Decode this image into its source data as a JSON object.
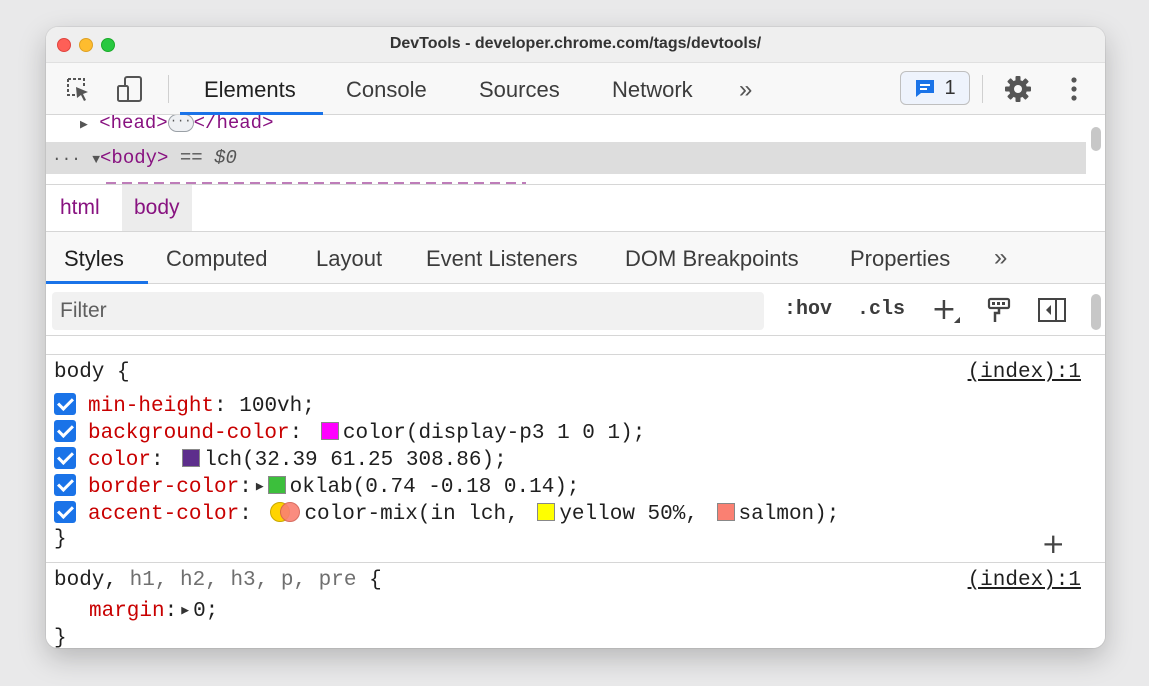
{
  "window": {
    "title": "DevTools - developer.chrome.com/tags/devtools/"
  },
  "toolbar": {
    "inspect_icon": "inspect-element-icon",
    "device_icon": "device-toolbar-icon",
    "tabs": [
      "Elements",
      "Console",
      "Sources",
      "Network"
    ],
    "active_tab": "Elements",
    "more": "»",
    "issues_count": "1",
    "settings_icon": "gear-icon",
    "menu_icon": "kebab-menu-icon"
  },
  "dom": {
    "head_open": "<head>",
    "head_ellipsis": "···",
    "head_close": "</head>",
    "body_dots": "···",
    "body_tag": "<body>",
    "body_eq": "==",
    "body_dollar": "$0"
  },
  "breadcrumbs": [
    "html",
    "body"
  ],
  "subtabs": {
    "items": [
      "Styles",
      "Computed",
      "Layout",
      "Event Listeners",
      "DOM Breakpoints",
      "Properties"
    ],
    "active": "Styles",
    "more": "»"
  },
  "filter": {
    "placeholder": "Filter",
    "hov": ":hov",
    "cls": ".cls",
    "add": "+"
  },
  "rules": [
    {
      "selector": "body",
      "open": "{",
      "source": "(index):1",
      "declarations": [
        {
          "prop": "min-height",
          "value": "100vh;"
        },
        {
          "prop": "background-color",
          "value": "color(display-p3 1 0 1);",
          "swatch": "#ff00ff"
        },
        {
          "prop": "color",
          "value": "lch(32.39 61.25 308.86);",
          "swatch": "#5d2e8c"
        },
        {
          "prop": "border-color",
          "value": "oklab(0.74 -0.18 0.14);",
          "swatch": "#3cbf3c"
        },
        {
          "prop": "accent-color",
          "value_prefix": "color-mix(in lch,",
          "yellow": "yellow 50%,",
          "salmon": "salmon);",
          "yellow_color": "#ffff00",
          "salmon_color": "#fa8072"
        }
      ],
      "close": "}"
    },
    {
      "selector_main": "body,",
      "selector_rest": "h1, h2, h3, p, pre",
      "open": "{",
      "source": "(index):1",
      "declarations": [
        {
          "prop": "margin",
          "value": "0;"
        }
      ],
      "close": "}"
    }
  ]
}
